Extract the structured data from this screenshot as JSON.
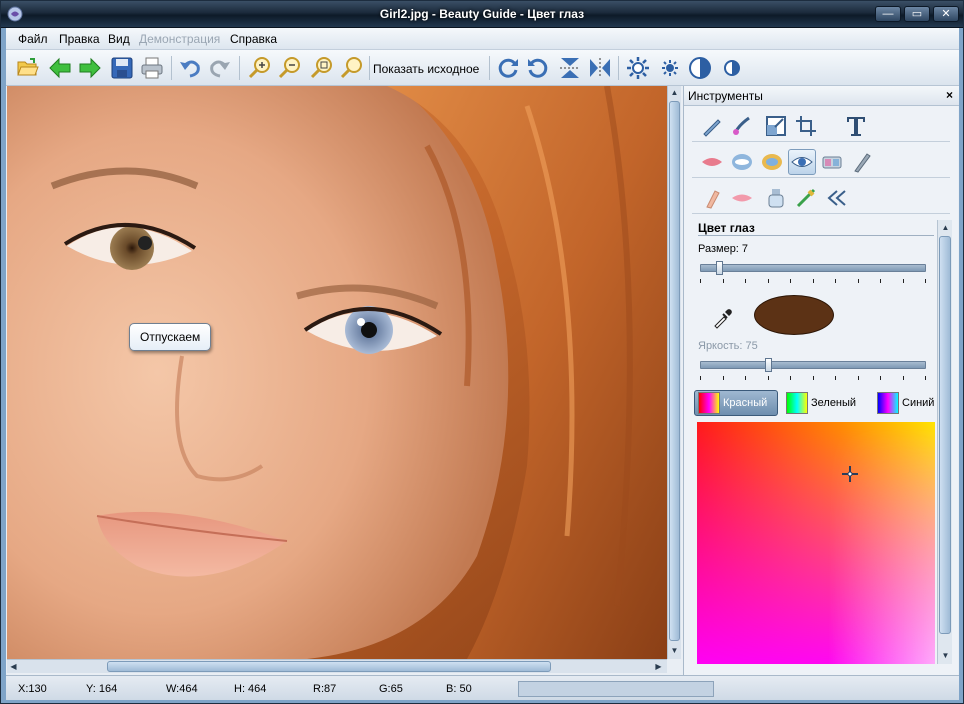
{
  "window": {
    "title": "Girl2.jpg - Beauty Guide - Цвет глаз",
    "min_glyph": "—",
    "max_glyph": "▭",
    "close_glyph": "✕"
  },
  "menu": {
    "file": "Файл",
    "edit": "Правка",
    "view": "Вид",
    "demo": "Демонстрация",
    "help": "Справка"
  },
  "toolbar": {
    "show_original": "Показать исходное",
    "icons": [
      "open-icon",
      "back-arrow-icon",
      "forward-arrow-icon",
      "save-icon",
      "print-icon",
      "undo-icon",
      "redo-icon",
      "zoom-in-icon",
      "zoom-out-icon",
      "zoom-fit-icon",
      "zoom-actual-icon",
      "rotate-cw-icon",
      "rotate-ccw-icon",
      "flip-vertical-icon",
      "flip-horizontal-icon",
      "brightness-up-icon",
      "brightness-down-icon",
      "contrast-up-icon",
      "contrast-down-icon"
    ]
  },
  "canvas": {
    "tooltip": "Отпускаем"
  },
  "panel": {
    "title": "Инструменты",
    "close": "×",
    "section_title": "Цвет глаз",
    "size_label": "Размер: 7",
    "size_value": 7,
    "brightness_label": "Яркость: 75",
    "brightness_value": 75,
    "swatch_color": "#5c3215",
    "channels": {
      "red": "Красный",
      "green": "Зеленый",
      "blue": "Синий"
    }
  },
  "status": {
    "x": "X:130",
    "y": "Y: 164",
    "w": "W:464",
    "h": "H: 464",
    "r": "R:87",
    "g": "G:65",
    "b": "B: 50"
  },
  "colors": {
    "frame": "#1b2a3b",
    "accent": "#7fa4c8"
  }
}
